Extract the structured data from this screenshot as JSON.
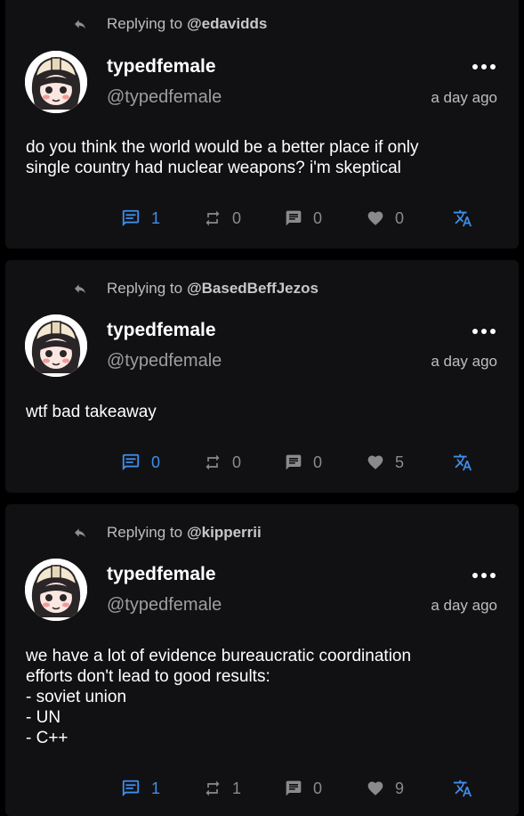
{
  "posts": [
    {
      "reply_prefix": "Replying to",
      "reply_to": "@edavidds",
      "display_name": "typedfemale",
      "username": "@typedfemale",
      "timestamp": "a day ago",
      "text": "do you think the world would be a better place if only\nsingle country had nuclear weapons? i'm skeptical",
      "replies": "1",
      "boosts": "0",
      "quotes": "0",
      "favorites": "0"
    },
    {
      "reply_prefix": "Replying to",
      "reply_to": "@BasedBeffJezos",
      "display_name": "typedfemale",
      "username": "@typedfemale",
      "timestamp": "a day ago",
      "text": "wtf bad takeaway",
      "replies": "0",
      "boosts": "0",
      "quotes": "0",
      "favorites": "5"
    },
    {
      "reply_prefix": "Replying to",
      "reply_to": "@kipperrii",
      "display_name": "typedfemale",
      "username": "@typedfemale",
      "timestamp": "a day ago",
      "text": "we have a lot of evidence bureaucratic coordination\nefforts don't lead to good results:\n- soviet union\n- UN\n- C++",
      "replies": "1",
      "boosts": "1",
      "quotes": "0",
      "favorites": "9"
    }
  ],
  "colors": {
    "background": "#000000",
    "card": "#111114",
    "accent": "#3f8fea",
    "muted": "#8a8a8a",
    "text": "#ffffff"
  },
  "icons": {
    "reply_indicator": "reply-arrow-icon",
    "more": "more-horizontal-icon",
    "reply": "comment-icon",
    "boost": "repeat-icon",
    "quote": "quote-bubble-icon",
    "favorite": "heart-icon",
    "translate": "translate-icon"
  }
}
